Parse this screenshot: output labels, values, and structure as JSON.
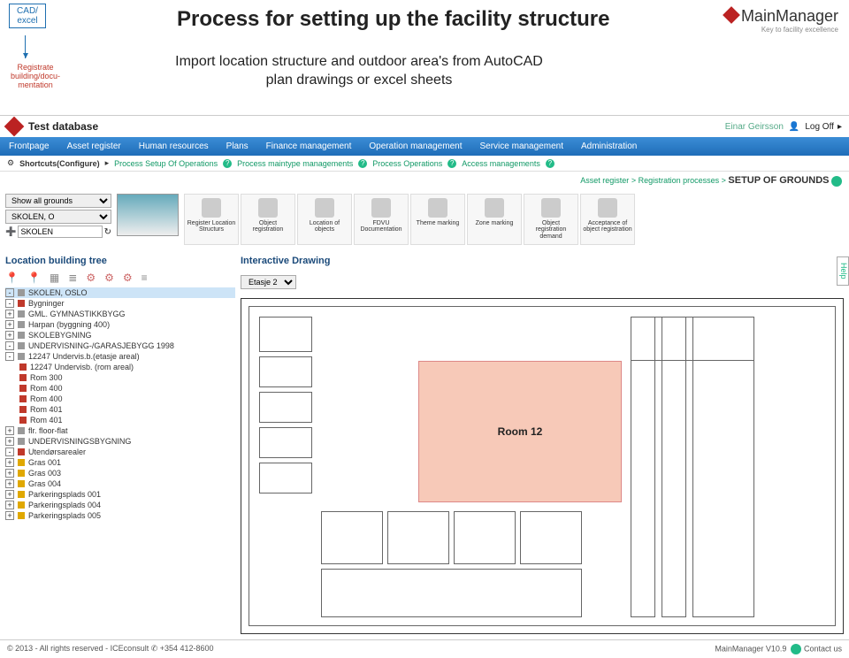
{
  "slide": {
    "cad_box_l1": "CAD/",
    "cad_box_l2": "excel",
    "reg_box": "Registrate building/docu-mentation",
    "title": "Process for setting up the facility structure",
    "subtitle_l1": "Import location structure and outdoor area's from AutoCAD",
    "subtitle_l2": "plan drawings or excel sheets",
    "brand": "MainManager",
    "brand_tag": "Key to facility excellence"
  },
  "app_top": {
    "db_name": "Test database",
    "user": "Einar Geirsson",
    "logoff": "Log Off"
  },
  "menubar": [
    "Frontpage",
    "Asset register",
    "Human resources",
    "Plans",
    "Finance management",
    "Operation management",
    "Service management",
    "Administration"
  ],
  "shortcuts": {
    "label": "Shortcuts(Configure)",
    "items": [
      "Process Setup Of Operations",
      "Process maintype managements",
      "Process Operations",
      "Access managements"
    ]
  },
  "breadcrumb": {
    "parts": [
      "Asset register",
      "Registration processes"
    ],
    "current": "SETUP OF GROUNDS"
  },
  "filters": {
    "all_grounds": "Show all grounds",
    "school_sel": "SKOLEN, O",
    "school_fixed": "SKOLEN"
  },
  "tiles": [
    "Register Location Structurs",
    "Object registration",
    "Location of objects",
    "FDVU Documentation",
    "Theme marking",
    "Zone marking",
    "Object registration demand",
    "Acceptance of object registration"
  ],
  "panel_left_title": "Location building tree",
  "panel_right_title": "Interactive Drawing",
  "floor_select": "Etasje 2",
  "room_label": "Room 12",
  "tree": [
    {
      "ind": 0,
      "exp": "-",
      "dot": "grey",
      "label": "SKOLEN, OSLO",
      "sel": true
    },
    {
      "ind": 1,
      "exp": "-",
      "dot": "red",
      "label": "Bygninger"
    },
    {
      "ind": 2,
      "exp": "+",
      "dot": "grey",
      "label": "GML. GYMNASTIKKBYGG"
    },
    {
      "ind": 2,
      "exp": "+",
      "dot": "grey",
      "label": "Harpan (byggning 400)"
    },
    {
      "ind": 2,
      "exp": "+",
      "dot": "grey",
      "label": "SKOLEBYGNING"
    },
    {
      "ind": 2,
      "exp": "-",
      "dot": "grey",
      "label": "UNDERVISNING-/GARASJEBYGG 1998"
    },
    {
      "ind": 3,
      "exp": "-",
      "dot": "grey",
      "label": "12247 Undervis.b.(etasje areal)"
    },
    {
      "ind": 4,
      "exp": "",
      "dot": "red",
      "label": "12247 Undervisb. (rom areal)"
    },
    {
      "ind": 4,
      "exp": "",
      "dot": "red",
      "label": "Rom 300"
    },
    {
      "ind": 4,
      "exp": "",
      "dot": "red",
      "label": "Rom 400"
    },
    {
      "ind": 4,
      "exp": "",
      "dot": "red",
      "label": "Rom 400"
    },
    {
      "ind": 4,
      "exp": "",
      "dot": "red",
      "label": "Rom 401"
    },
    {
      "ind": 4,
      "exp": "",
      "dot": "red",
      "label": "Rom 401"
    },
    {
      "ind": 3,
      "exp": "+",
      "dot": "grey",
      "label": "flr. floor-flat"
    },
    {
      "ind": 2,
      "exp": "+",
      "dot": "grey",
      "label": "UNDERVISNINGSBYGNING"
    },
    {
      "ind": 1,
      "exp": "-",
      "dot": "red",
      "label": "Utendørsarealer"
    },
    {
      "ind": 2,
      "exp": "+",
      "dot": "gold",
      "label": "Gras 001"
    },
    {
      "ind": 2,
      "exp": "+",
      "dot": "gold",
      "label": "Gras 003"
    },
    {
      "ind": 2,
      "exp": "+",
      "dot": "gold",
      "label": "Gras 004"
    },
    {
      "ind": 2,
      "exp": "+",
      "dot": "gold",
      "label": "Parkeringsplads 001"
    },
    {
      "ind": 2,
      "exp": "+",
      "dot": "gold",
      "label": "Parkeringsplads 004"
    },
    {
      "ind": 2,
      "exp": "+",
      "dot": "gold",
      "label": "Parkeringsplads 005"
    }
  ],
  "footer": {
    "left": "© 2013 - All rights reserved - ICEconsult  ✆ +354 412-8600",
    "right": "MainManager V10.9",
    "contact": "Contact us"
  },
  "help": "Help"
}
